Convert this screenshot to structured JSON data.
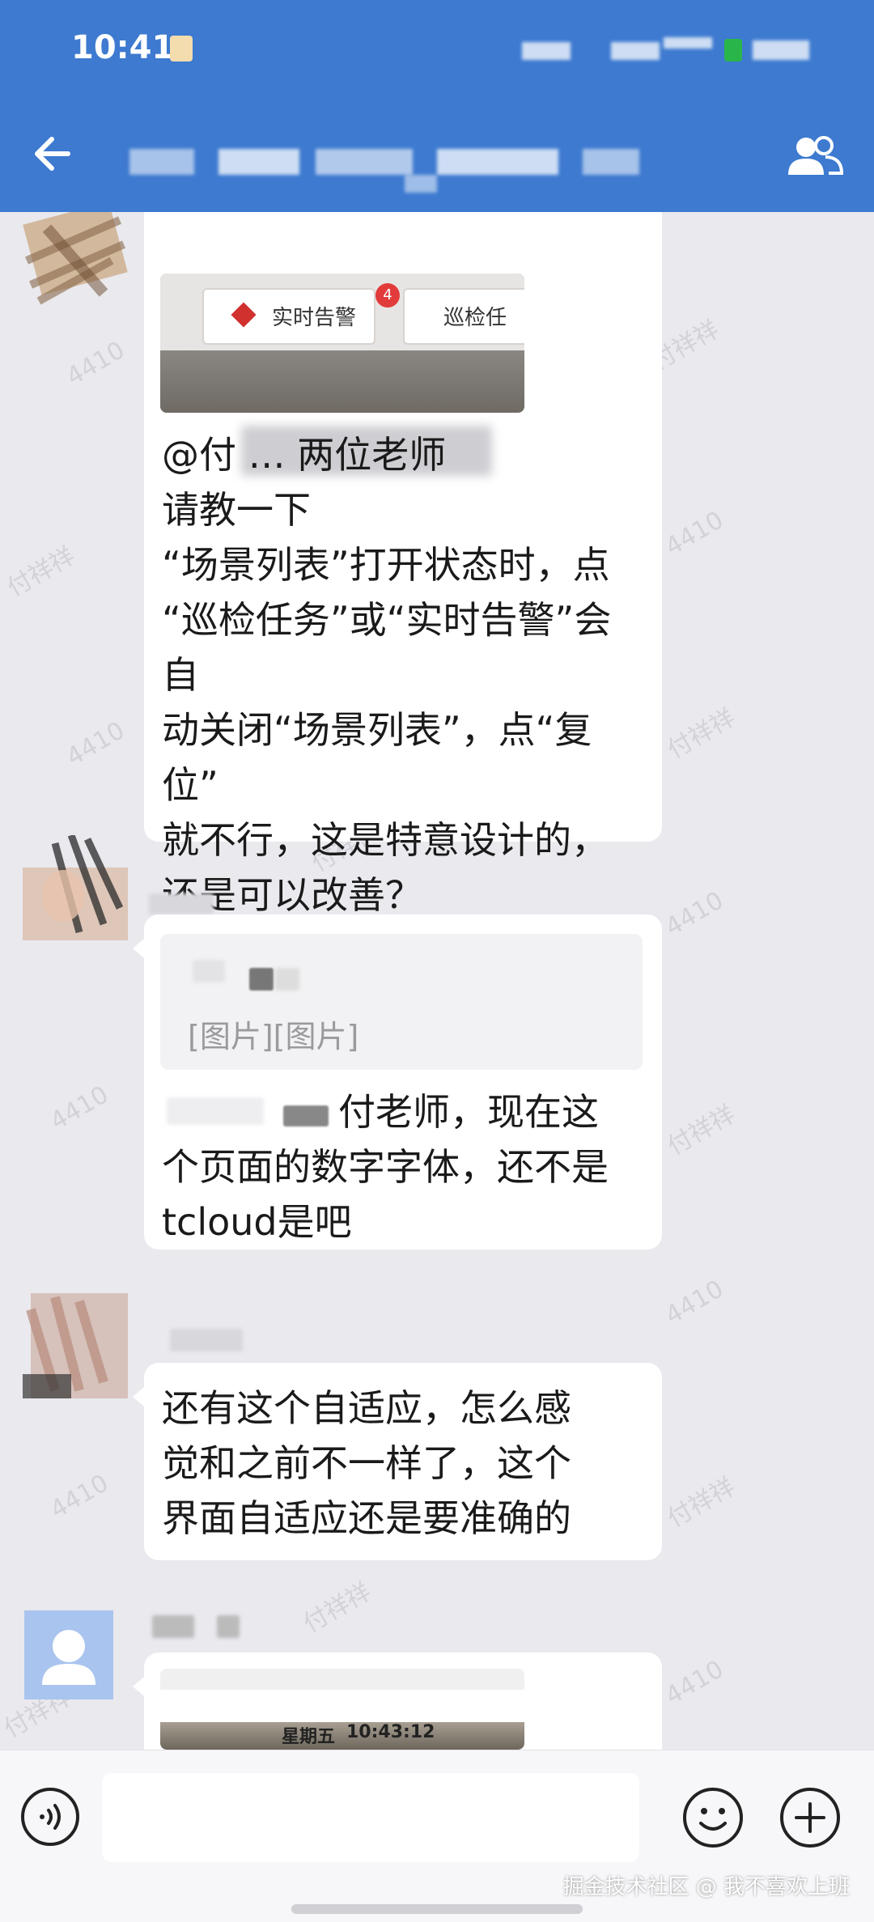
{
  "status_bar": {
    "time": "10:41"
  },
  "chat": {
    "messages": [
      {
        "sender": "",
        "lines": [
          "@付 … 两位老师",
          "请教一下",
          "“场景列表”打开状态时，点",
          "“巡检任务”或“实时告警”会自",
          "动关闭“场景列表”，点“复位”",
          "就不行，这是特意设计的，",
          "还是可以改善？"
        ],
        "image_labels": {
          "alarm_tab": "实时告警",
          "alarm_badge": "4",
          "inspection_tab": "巡检任"
        }
      },
      {
        "quote": "[图片][图片]",
        "lines": [
          "付老师，现在这",
          "个页面的数字字体，还不是",
          "tcloud是吧"
        ]
      },
      {
        "lines": [
          "还有这个自适应，怎么感",
          "觉和之前不一样了，这个",
          "界面自适应还是要准确的"
        ]
      },
      {
        "image_labels": {
          "weekday": "星期五",
          "clock": "10:43:12"
        }
      }
    ],
    "watermark": "付祥祥",
    "watermark_id": "4410"
  },
  "input_bar": {
    "placeholder": "",
    "footer_watermark": "掘金技术社区 @ 我不喜欢上班"
  },
  "colors": {
    "header": "#3d7ad0",
    "chat_bg": "#e9e9ee",
    "bubble": "#ffffff"
  },
  "icons": [
    "back-arrow-icon",
    "contacts-icon",
    "voice-icon",
    "emoji-icon",
    "plus-icon"
  ]
}
